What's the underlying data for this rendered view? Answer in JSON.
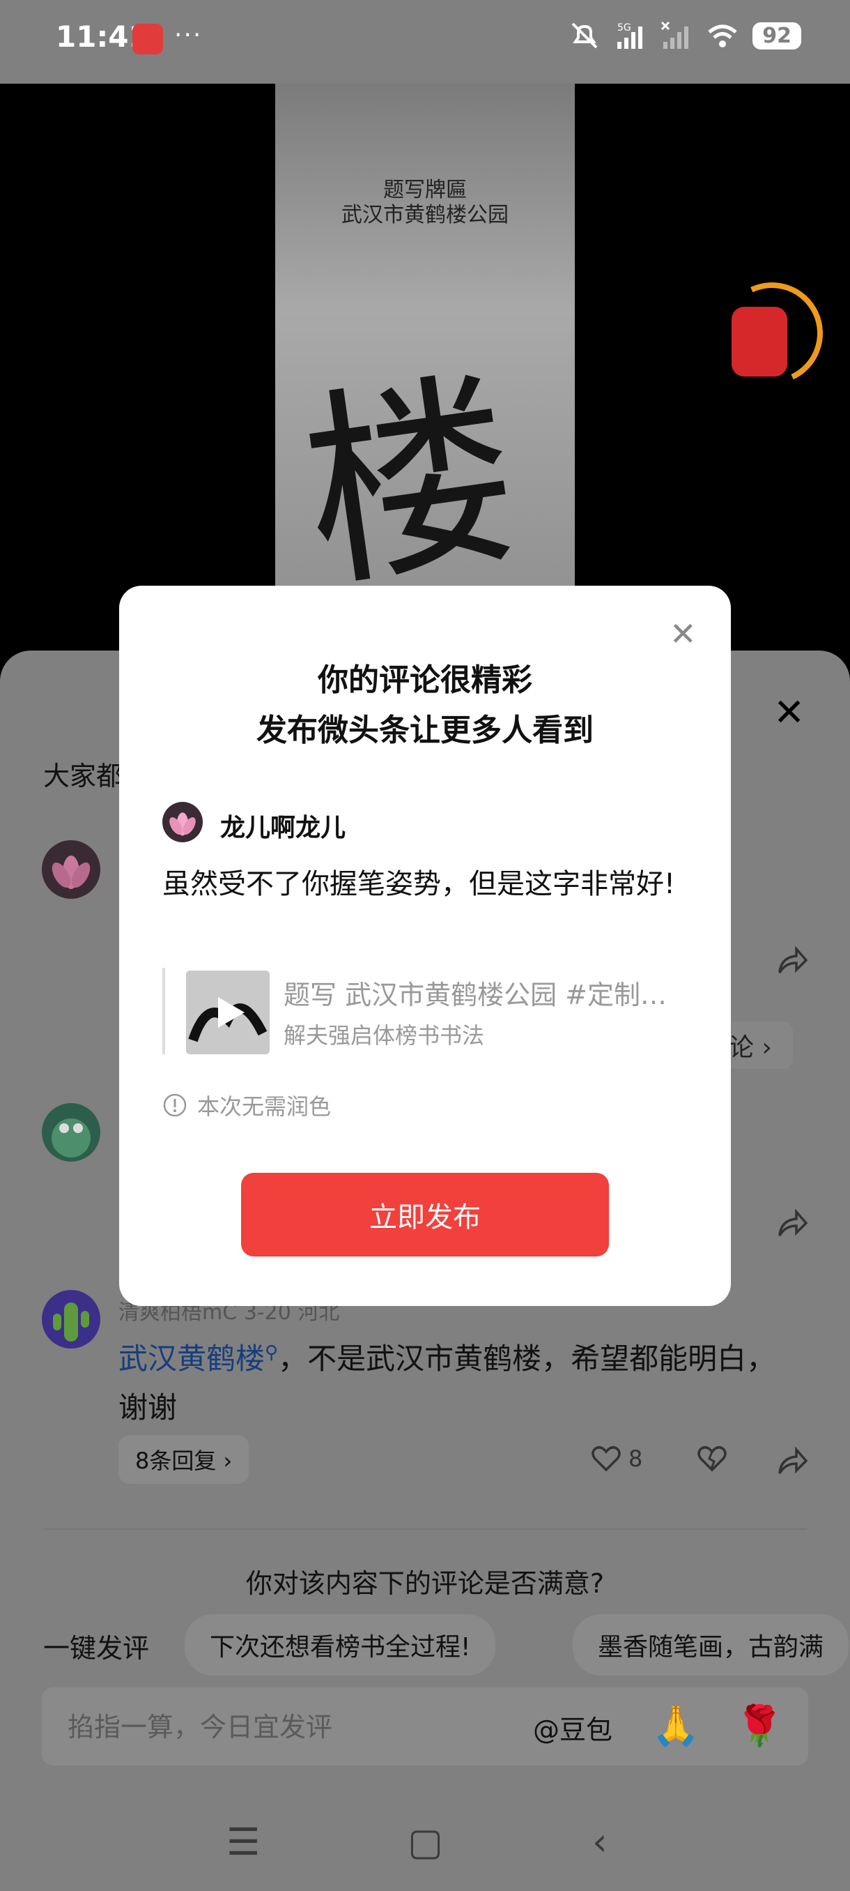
{
  "status_bar": {
    "time": "11:41",
    "more": "···",
    "network": "5G",
    "battery": "92"
  },
  "video": {
    "caption_line1": "题写牌匾",
    "caption_line2": "武汉市黄鹤楼公园",
    "glyph": "楼"
  },
  "sheet": {
    "heading": "大家都",
    "partial_chip": "论 ›",
    "comment3": {
      "meta": "清爽柏梧mC  3-20  河北",
      "link": "武汉黄鹤楼",
      "body": "，不是武汉市黄鹤楼，希望都能明白，谢谢",
      "replies": "8条回复 ›",
      "likes": "8"
    },
    "survey_question": "你对该内容下的评论是否满意?",
    "quick_label": "一键发评",
    "quick_chips": [
      "下次还想看榜书全过程!",
      "墨香随笔画，古韵满"
    ],
    "input_placeholder": "掐指一算，今日宜发评",
    "doubao": "@豆包",
    "emoji_pray": "🙏",
    "emoji_rose": "🌹"
  },
  "modal": {
    "title_line1": "你的评论很精彩",
    "title_line2": "发布微头条让更多人看到",
    "username": "龙儿啊龙儿",
    "comment": "虽然受不了你握笔姿势，但是这字非常好!",
    "card_title": "题写 武汉市黄鹤楼公园 #定制牌匾",
    "card_subtitle": "解夫强启体榜书书法",
    "note": "本次无需润色",
    "publish_button": "立即发布"
  },
  "colors": {
    "primary_button": "#f2403c",
    "dim_overlay": "#808080",
    "link": "#173d7d"
  }
}
